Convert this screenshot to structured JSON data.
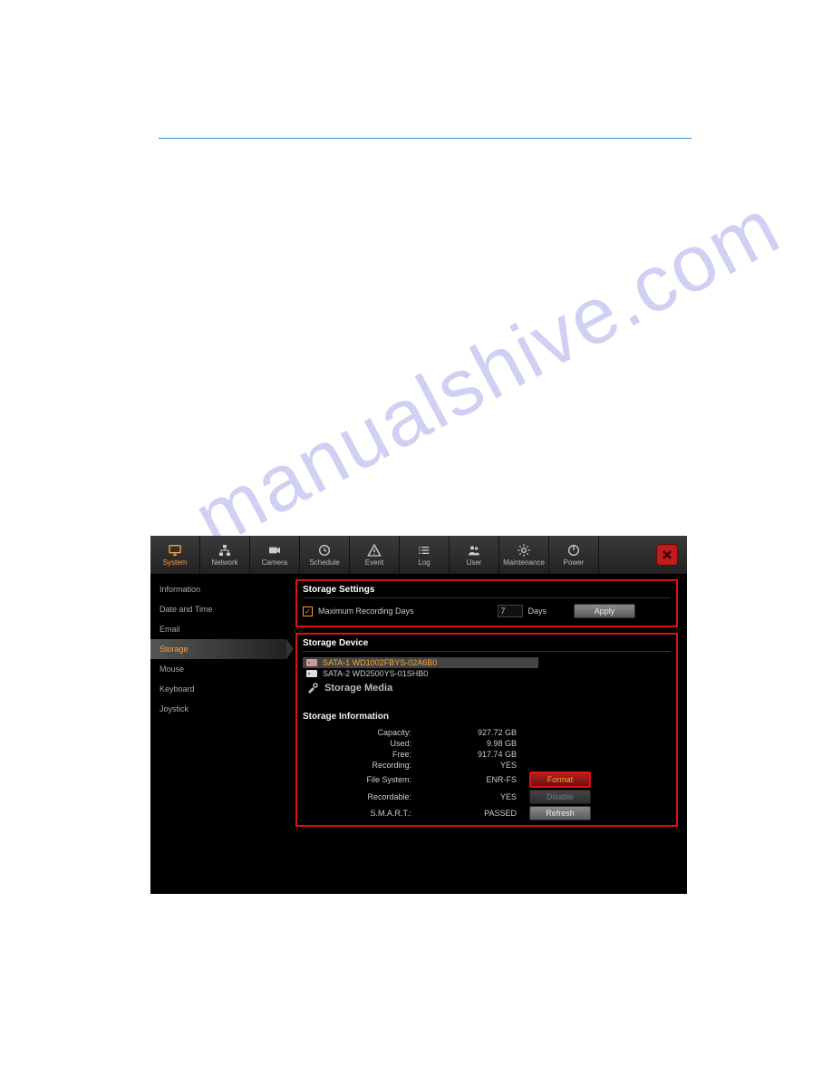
{
  "watermark": "manualshive.com",
  "nav": [
    {
      "key": "system",
      "label": "System"
    },
    {
      "key": "network",
      "label": "Network"
    },
    {
      "key": "camera",
      "label": "Camera"
    },
    {
      "key": "schedule",
      "label": "Schedule"
    },
    {
      "key": "event",
      "label": "Event"
    },
    {
      "key": "log",
      "label": "Log"
    },
    {
      "key": "user",
      "label": "User"
    },
    {
      "key": "maintenance",
      "label": "Maintenance"
    },
    {
      "key": "power",
      "label": "Power"
    }
  ],
  "nav_active": "system",
  "sidebar": {
    "items": [
      {
        "key": "information",
        "label": "Information"
      },
      {
        "key": "datetime",
        "label": "Date and Time"
      },
      {
        "key": "email",
        "label": "Email"
      },
      {
        "key": "storage",
        "label": "Storage"
      },
      {
        "key": "mouse",
        "label": "Mouse"
      },
      {
        "key": "keyboard",
        "label": "Keyboard"
      },
      {
        "key": "joystick",
        "label": "Joystick"
      }
    ],
    "active": "storage"
  },
  "settings_panel": {
    "title": "Storage Settings",
    "checkbox_label": "Maximum Recording Days",
    "checkbox_checked": true,
    "days_value": "7",
    "days_unit": "Days",
    "apply_label": "Apply"
  },
  "device_panel": {
    "title": "Storage Device",
    "devices": [
      {
        "label": "SATA-1 WD1002FBYS-02A6B0",
        "selected": true
      },
      {
        "label": "SATA-2 WD2500YS-01SHB0",
        "selected": false
      }
    ],
    "media_label": "Storage Media",
    "info_title": "Storage Information",
    "rows": [
      {
        "label": "Capacity:",
        "value": "927.72 GB",
        "button": null
      },
      {
        "label": "Used:",
        "value": "9.98 GB",
        "button": null
      },
      {
        "label": "Free:",
        "value": "917.74 GB",
        "button": null
      },
      {
        "label": "Recording:",
        "value": "YES",
        "button": null
      },
      {
        "label": "File System:",
        "value": "ENR-FS",
        "button": {
          "label": "Format",
          "style": "red"
        }
      },
      {
        "label": "Recordable:",
        "value": "YES",
        "button": {
          "label": "Disable",
          "style": "disabled"
        }
      },
      {
        "label": "S.M.A.R.T.:",
        "value": "PASSED",
        "button": {
          "label": "Refresh",
          "style": "normal"
        }
      }
    ]
  }
}
